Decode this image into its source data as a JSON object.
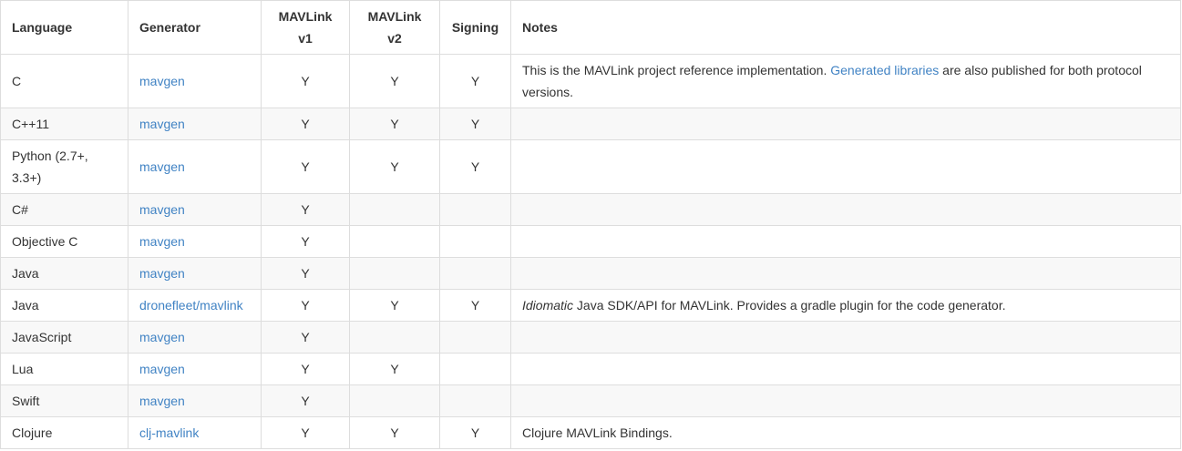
{
  "headers": {
    "language": "Language",
    "generator": "Generator",
    "v1_line1": "MAVLink",
    "v1_line2": "v1",
    "v2_line1": "MAVLink",
    "v2_line2": "v2",
    "signing": "Signing",
    "notes": "Notes"
  },
  "rows": [
    {
      "language_l1": "C",
      "generator": "mavgen",
      "v1": "Y",
      "v2": "Y",
      "signing": "Y",
      "notes_pre": "This is the MAVLink project reference implementation. ",
      "notes_link": "Generated libraries",
      "notes_post": " are also published for both protocol versions."
    },
    {
      "language_l1": "C++11",
      "generator": "mavgen",
      "v1": "Y",
      "v2": "Y",
      "signing": "Y"
    },
    {
      "language_l1": "Python (2.7+,",
      "language_l2": "3.3+)",
      "generator": "mavgen",
      "v1": "Y",
      "v2": "Y",
      "signing": "Y"
    },
    {
      "language_l1": "C#",
      "generator": "mavgen",
      "v1": "Y"
    },
    {
      "language_l1": "Objective C",
      "generator": "mavgen",
      "v1": "Y"
    },
    {
      "language_l1": "Java",
      "generator": "mavgen",
      "v1": "Y"
    },
    {
      "language_l1": "Java",
      "generator": "dronefleet/mavlink",
      "v1": "Y",
      "v2": "Y",
      "signing": "Y",
      "notes_em": "Idiomatic",
      "notes_post": " Java SDK/API for MAVLink. Provides a gradle plugin for the code generator."
    },
    {
      "language_l1": "JavaScript",
      "generator": "mavgen",
      "v1": "Y"
    },
    {
      "language_l1": "Lua",
      "generator": "mavgen",
      "v1": "Y",
      "v2": "Y"
    },
    {
      "language_l1": "Swift",
      "generator": "mavgen",
      "v1": "Y"
    },
    {
      "language_l1": "Clojure",
      "generator": "clj-mavlink",
      "v1": "Y",
      "v2": "Y",
      "signing": "Y",
      "notes_post": "Clojure MAVLink Bindings."
    }
  ],
  "colors": {
    "link": "#4183c4",
    "text": "#333333",
    "border": "#dddddd",
    "stripe": "#f8f8f8"
  }
}
